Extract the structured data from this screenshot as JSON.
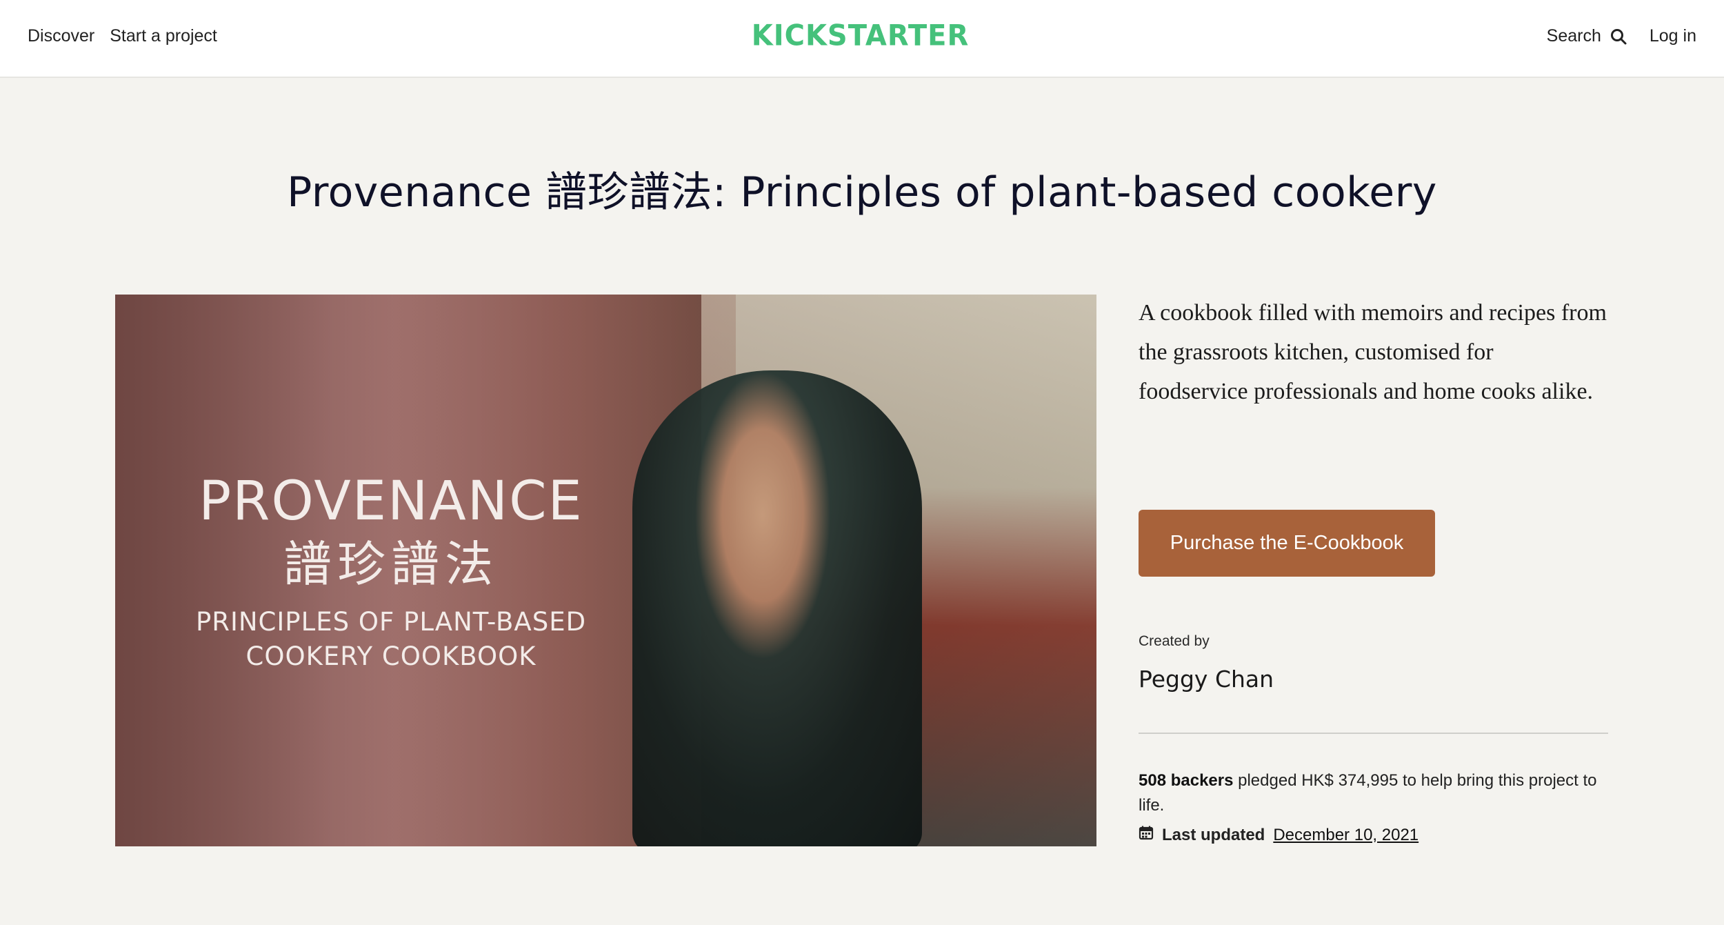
{
  "header": {
    "nav_left": [
      {
        "label": "Discover"
      },
      {
        "label": "Start a project"
      }
    ],
    "logo_text": "KICKSTARTER",
    "search_label": "Search",
    "login_label": "Log in",
    "brand_color": "#45c17b"
  },
  "page": {
    "title": "Provenance 譜珍譜法: Principles of plant-based cookery"
  },
  "hero": {
    "title_line1": "PROVENANCE",
    "title_line2": "譜珍譜法",
    "subtitle_line1": "PRINCIPLES OF PLANT-BASED",
    "subtitle_line2": "COOKERY COOKBOOK"
  },
  "project": {
    "blurb": "A cookbook filled with memoirs and recipes from the grassroots kitchen, customised for foodservice professionals and home cooks alike.",
    "cta_label": "Purchase the E-Cookbook",
    "cta_color": "#a8623a",
    "created_by_label": "Created by",
    "creator_name": "Peggy Chan",
    "backers_label": "508 backers",
    "funding_text": " pledged HK$ 374,995 to help bring this project to life.",
    "last_updated_label": "Last updated",
    "last_updated_date": "December 10, 2021"
  },
  "icons": {
    "search": "search-icon",
    "calendar": "calendar-icon"
  }
}
